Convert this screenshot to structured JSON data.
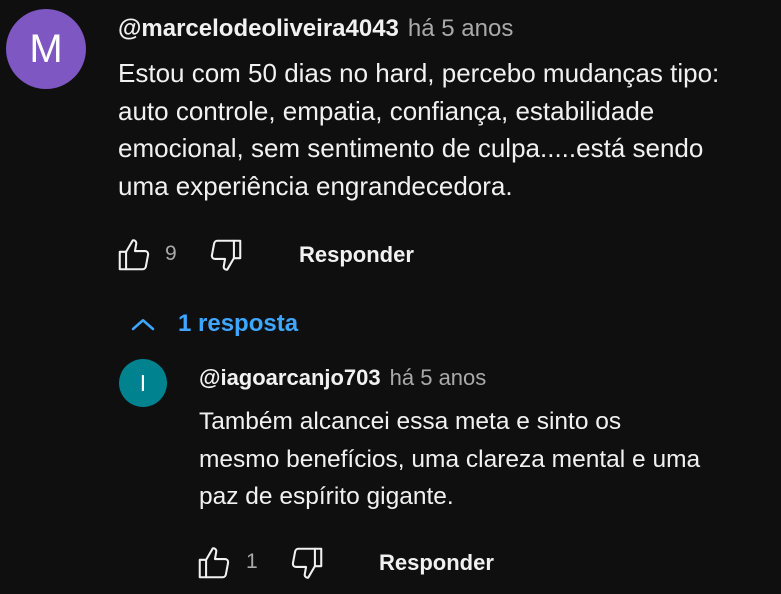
{
  "comment": {
    "avatar_letter": "M",
    "avatar_color": "#7e57c2",
    "author": "@marcelodeoliveira4043",
    "time": "há 5 anos",
    "text_lines": [
      "Estou com 50 dias no hard, percebo mudanças tipo:",
      "auto controle, empatia, confiança, estabilidade",
      "emocional, sem sentimento de culpa.....está sendo",
      "uma experiência engrandecedora."
    ],
    "like_count": "9",
    "reply_label": "Responder",
    "replies_toggle_label": "1 resposta"
  },
  "reply": {
    "avatar_letter": "I",
    "avatar_color": "#00838f",
    "author": "@iagoarcanjo703",
    "time": "há 5 anos",
    "text_lines": [
      "Também alcancei essa meta e sinto os",
      "mesmo benefícios, uma clareza mental e uma",
      "paz de espírito gigante."
    ],
    "like_count": "1",
    "reply_label": "Responder"
  },
  "colors": {
    "background": "#0f0f0f",
    "text": "#f1f1f1",
    "secondary_text": "#aaaaaa",
    "link_blue": "#3ea6ff"
  },
  "icons": {
    "like": "thumbs-up-outline-icon",
    "dislike": "thumbs-down-outline-icon",
    "toggle": "chevron-up-icon"
  }
}
